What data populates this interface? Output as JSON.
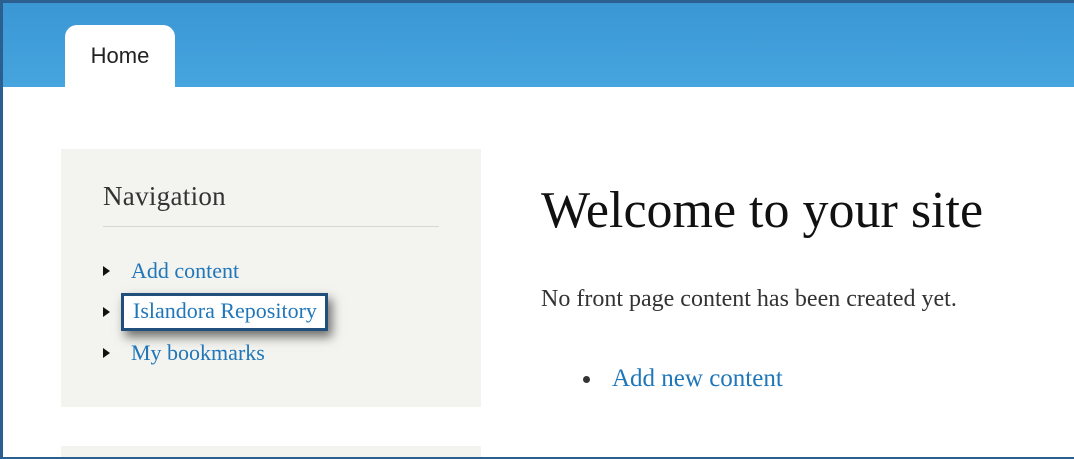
{
  "header": {
    "tabs": [
      {
        "label": "Home"
      }
    ]
  },
  "sidebar": {
    "title": "Navigation",
    "items": [
      {
        "label": "Add content"
      },
      {
        "label": "Islandora Repository"
      },
      {
        "label": "My bookmarks"
      }
    ]
  },
  "main": {
    "title": "Welcome to your site",
    "message": "No front page content has been created yet.",
    "links": [
      {
        "label": "Add new content"
      }
    ]
  },
  "colors": {
    "header": "#3a97d4",
    "link": "#1f76b8",
    "sidebar_bg": "#f3f3ef",
    "highlight_border": "#1f4f7a"
  }
}
